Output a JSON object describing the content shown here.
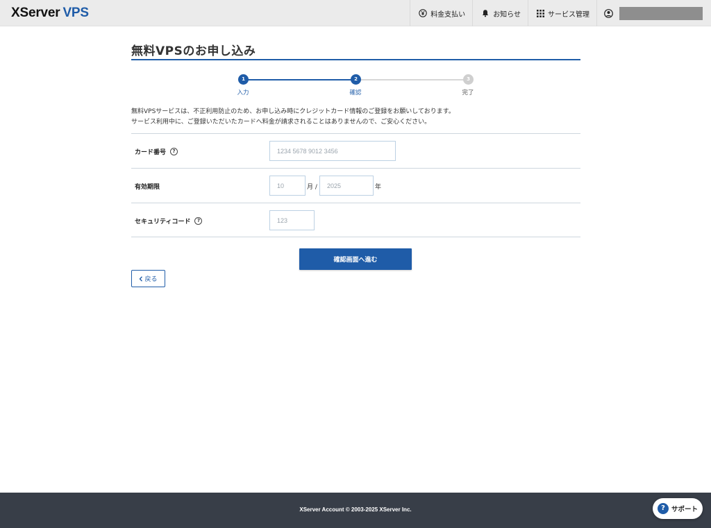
{
  "header": {
    "logo_main": "XServer",
    "logo_accent": "VPS",
    "nav": {
      "billing": "料金支払い",
      "notices": "お知らせ",
      "service_management": "サービス管理"
    }
  },
  "main": {
    "page_title": "無料VPSのお申し込み",
    "steps": [
      {
        "number": "1",
        "label": "入力",
        "state": "done"
      },
      {
        "number": "2",
        "label": "確認",
        "state": "active"
      },
      {
        "number": "3",
        "label": "完了",
        "state": "pending"
      }
    ],
    "intro_lines": [
      "無料VPSサービスは、不正利用防止のため、お申し込み時にクレジットカード情報のご登録をお願いしております。",
      "サービス利用中に、ご登録いただいたカードへ料金が請求されることはありませんので、ご安心ください。"
    ],
    "form": {
      "card_number_label": "カード番号",
      "card_number_placeholder": "1234 5678 9012 3456",
      "expiry_label": "有効期限",
      "expiry_month_placeholder": "10",
      "expiry_month_unit": "月 /",
      "expiry_year_placeholder": "2025",
      "expiry_year_unit": "年",
      "security_code_label": "セキュリティコード",
      "security_code_placeholder": "123",
      "help_glyph": "?"
    },
    "confirm_button": "確認画面へ進む",
    "back_button": "戻る"
  },
  "footer": {
    "copyright": "XServer Account © 2003-2025 XServer Inc."
  },
  "support": {
    "label": "サポート",
    "icon_glyph": "?"
  },
  "colors": {
    "brand": "#1f5ca8",
    "footer_bg": "#383e48",
    "header_bg": "#ebebeb"
  }
}
